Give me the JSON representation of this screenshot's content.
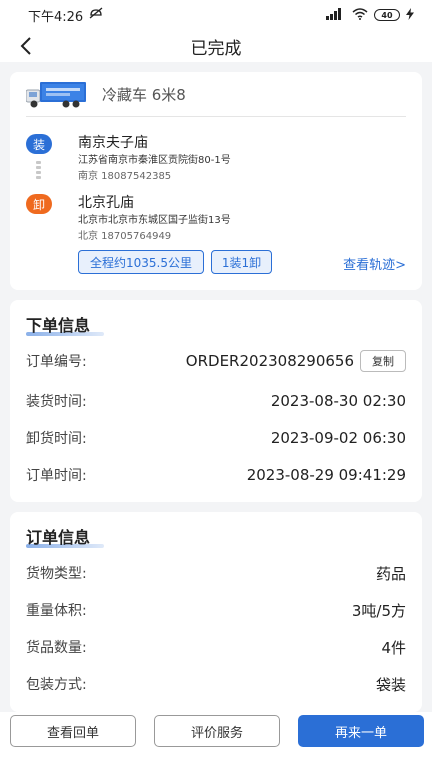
{
  "status_bar": {
    "time": "下午4:26",
    "signal": "HD",
    "battery": "40"
  },
  "nav": {
    "title": "已完成"
  },
  "vehicle": {
    "description": "冷藏车  6米8"
  },
  "route": {
    "load_badge": "装",
    "unload_badge": "卸",
    "origin": {
      "name": "南京夫子庙",
      "address": "江苏省南京市秦淮区贡院街80-1号",
      "contact": "南京  18087542385"
    },
    "destination": {
      "name": "北京孔庙",
      "address": "北京市北京市东城区国子监街13号",
      "contact": "北京  18705764949"
    },
    "distance_tag": "全程约1035.5公里",
    "stops_tag": "1装1卸",
    "track_link": "查看轨迹>"
  },
  "order_info": {
    "title": "下单信息",
    "rows": [
      {
        "label": "订单编号:",
        "value": "ORDER202308290656"
      },
      {
        "label": "装货时间:",
        "value": "2023-08-30 02:30"
      },
      {
        "label": "卸货时间:",
        "value": "2023-09-02 06:30"
      },
      {
        "label": "订单时间:",
        "value": "2023-08-29 09:41:29"
      }
    ],
    "copy_label": "复制"
  },
  "goods_info": {
    "title": "订单信息",
    "rows": [
      {
        "label": "货物类型:",
        "value": "药品"
      },
      {
        "label": "重量体积:",
        "value": "3吨/5方"
      },
      {
        "label": "货品数量:",
        "value": "4件"
      },
      {
        "label": "包装方式:",
        "value": "袋装"
      }
    ]
  },
  "actions": {
    "receipt": "查看回单",
    "rate": "评价服务",
    "reorder": "再来一单"
  },
  "colors": {
    "accent": "#2b6fd6",
    "unload": "#ef6a1f",
    "background": "#f3f4f6"
  }
}
